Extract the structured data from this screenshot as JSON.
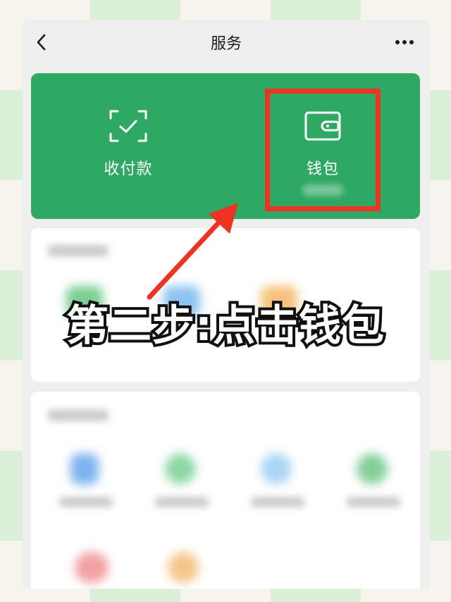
{
  "header": {
    "title": "服务",
    "back_icon": "chevron-left-icon",
    "more_icon": "more-dots-icon"
  },
  "green_panel": {
    "color": "#2fa864",
    "items": [
      {
        "label": "收付款",
        "icon": "scan-check-icon"
      },
      {
        "label": "钱包",
        "icon": "wallet-icon"
      }
    ]
  },
  "annotation": {
    "text": "第二步:点击钱包",
    "highlight_color": "#ee3324",
    "arrow_color": "#ee3324"
  }
}
